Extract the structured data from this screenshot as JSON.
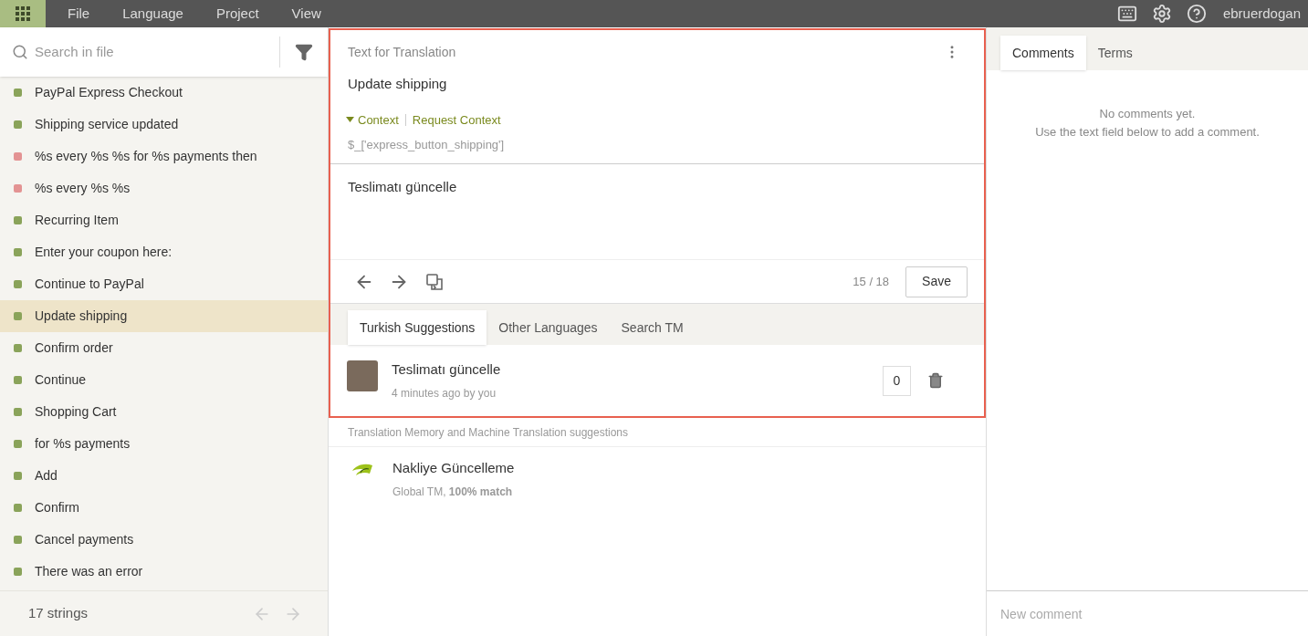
{
  "menu": {
    "items": [
      "File",
      "Language",
      "Project",
      "View"
    ],
    "user": "ebruerdogan"
  },
  "sidebar": {
    "search": {
      "placeholder": "Search in file"
    },
    "strings": [
      {
        "text": "PayPal Express Checkout",
        "color": "#8aa35a",
        "selected": false
      },
      {
        "text": "Shipping service updated",
        "color": "#8aa35a",
        "selected": false
      },
      {
        "text": "%s every %s %s for %s payments then",
        "color": "#e39393",
        "selected": false
      },
      {
        "text": "%s every %s %s",
        "color": "#e39393",
        "selected": false
      },
      {
        "text": "Recurring Item",
        "color": "#8aa35a",
        "selected": false
      },
      {
        "text": "Enter your coupon here:",
        "color": "#8aa35a",
        "selected": false
      },
      {
        "text": "Continue to PayPal",
        "color": "#8aa35a",
        "selected": false
      },
      {
        "text": "Update shipping",
        "color": "#8aa35a",
        "selected": true
      },
      {
        "text": "Confirm order",
        "color": "#8aa35a",
        "selected": false
      },
      {
        "text": "Continue",
        "color": "#8aa35a",
        "selected": false
      },
      {
        "text": "Shopping Cart",
        "color": "#8aa35a",
        "selected": false
      },
      {
        "text": "for %s payments",
        "color": "#8aa35a",
        "selected": false
      },
      {
        "text": "Add",
        "color": "#8aa35a",
        "selected": false
      },
      {
        "text": "Confirm",
        "color": "#8aa35a",
        "selected": false
      },
      {
        "text": "Cancel payments",
        "color": "#8aa35a",
        "selected": false
      },
      {
        "text": "There was an error",
        "color": "#8aa35a",
        "selected": false
      }
    ],
    "footer": "17 strings"
  },
  "editor": {
    "header": "Text for Translation",
    "source": "Update shipping",
    "context_toggle": "Context",
    "request_context": "Request Context",
    "key": "$_['express_button_shipping']",
    "translation": "Teslimatı güncelle",
    "counter": "15 / 18",
    "save": "Save"
  },
  "suggestion_tabs": [
    {
      "label": "Turkish Suggestions",
      "selected": true
    },
    {
      "label": "Other Languages",
      "selected": false
    },
    {
      "label": "Search TM",
      "selected": false
    }
  ],
  "suggestions": [
    {
      "text": "Teslimatı güncelle",
      "meta": "4 minutes ago by you",
      "votes": "0"
    }
  ],
  "tm": {
    "label": "Translation Memory and Machine Translation suggestions",
    "items": [
      {
        "text": "Nakliye Güncelleme",
        "meta": "Global TM, **100% match**"
      }
    ]
  },
  "right_tabs": [
    {
      "label": "Comments",
      "selected": true
    },
    {
      "label": "Terms",
      "selected": false
    }
  ],
  "comments": {
    "empty": [
      "No comments yet.",
      "Use the text field below to add a comment."
    ],
    "placeholder": "New comment"
  }
}
